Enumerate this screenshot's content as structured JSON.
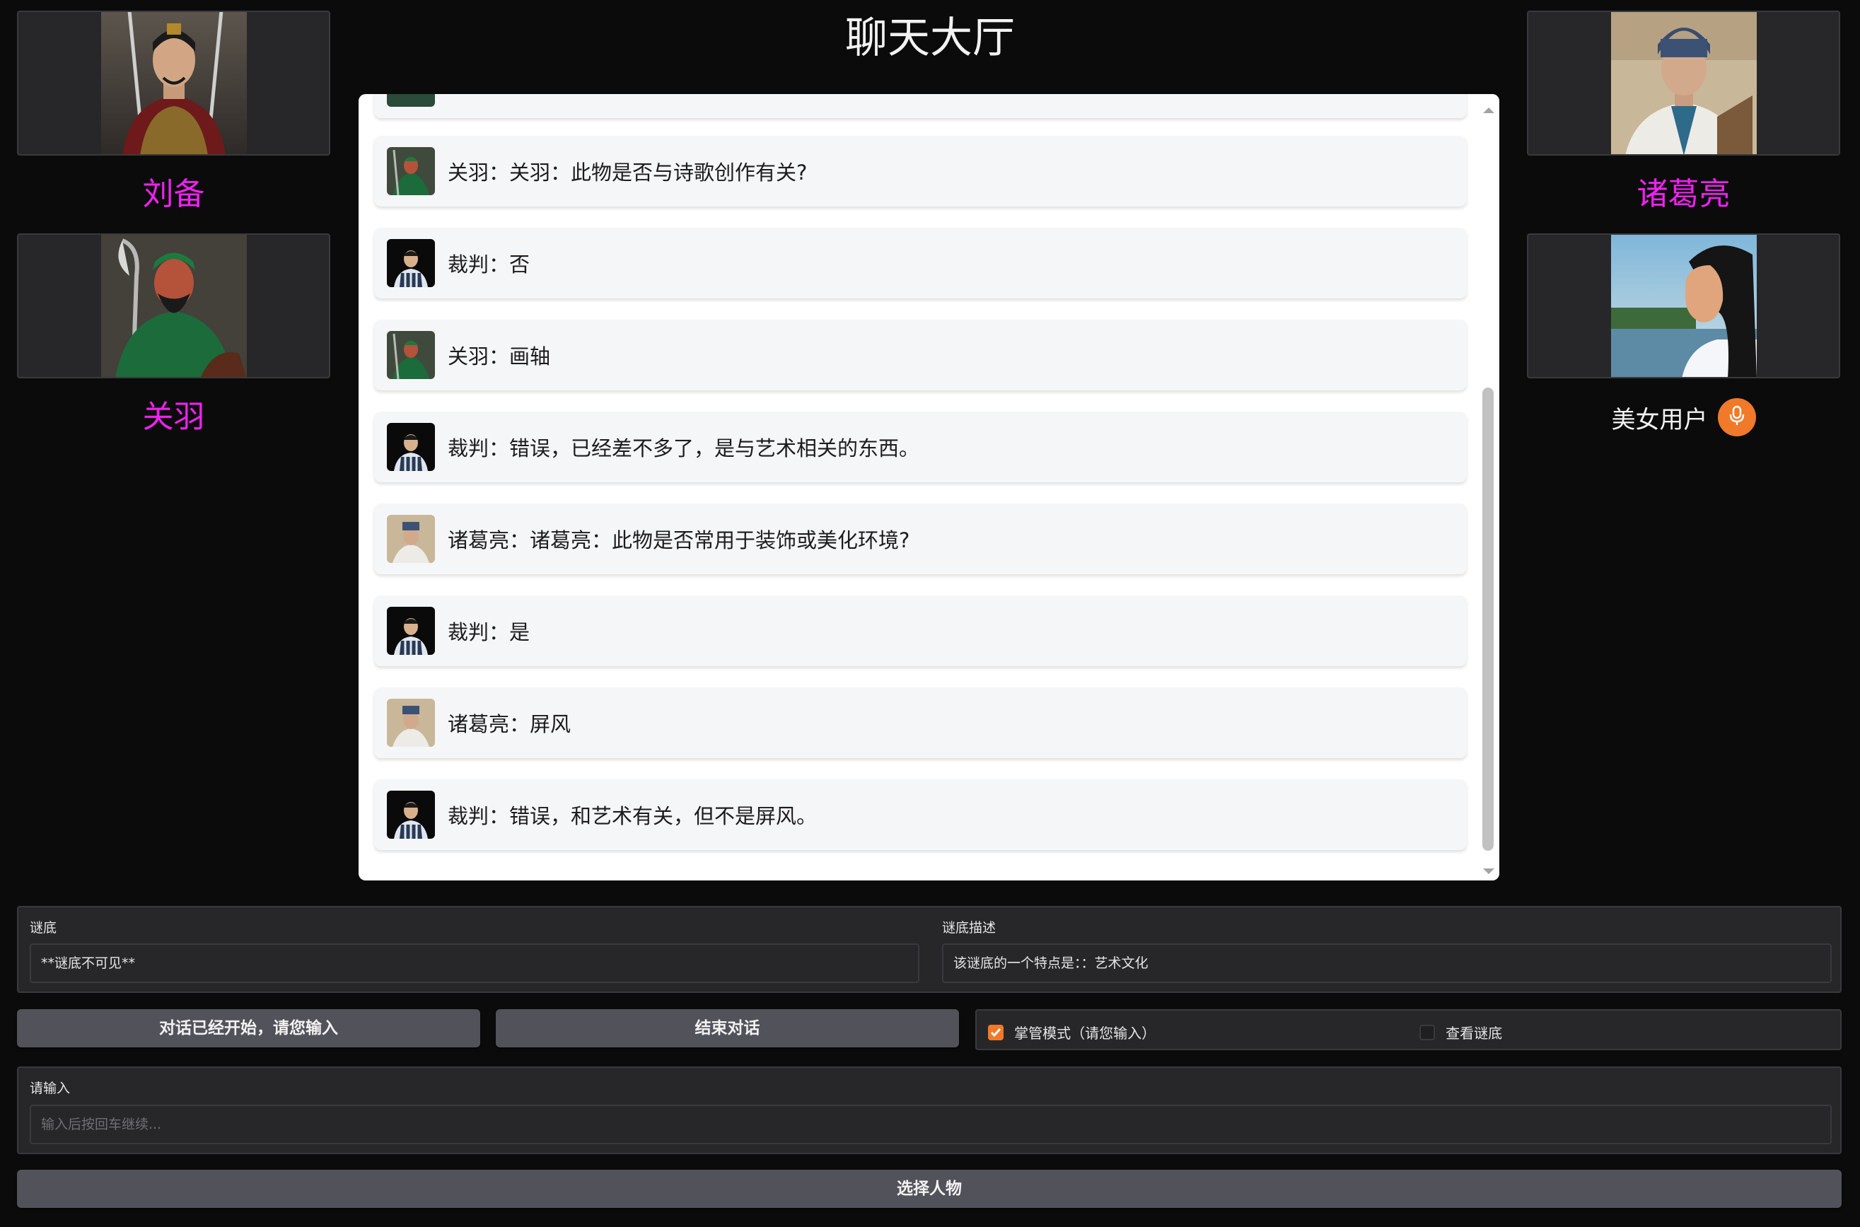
{
  "header": {
    "title": "聊天大厅"
  },
  "characters": {
    "left": [
      {
        "name": "刘备"
      },
      {
        "name": "关羽"
      }
    ],
    "right": [
      {
        "name": "诸葛亮"
      }
    ],
    "user": {
      "name": "美女用户",
      "icon": "microphone-icon",
      "accent": "#f07a2a"
    }
  },
  "chat": {
    "messages": [
      {
        "speaker": "guanyu",
        "text": "关羽：关羽：此物是否与诗歌创作有关?"
      },
      {
        "speaker": "referee",
        "text": "裁判：否"
      },
      {
        "speaker": "guanyu",
        "text": "关羽：画轴"
      },
      {
        "speaker": "referee",
        "text": "裁判：错误，已经差不多了，是与艺术相关的东西。"
      },
      {
        "speaker": "zhuge",
        "text": "诸葛亮：诸葛亮：此物是否常用于装饰或美化环境?"
      },
      {
        "speaker": "referee",
        "text": "裁判：是"
      },
      {
        "speaker": "zhuge",
        "text": "诸葛亮：屏风"
      },
      {
        "speaker": "referee",
        "text": "裁判：错误，和艺术有关，但不是屏风。"
      }
    ]
  },
  "riddle": {
    "answer_label": "谜底",
    "answer_value": "**谜底不可见**",
    "desc_label": "谜底描述",
    "desc_value": "该谜底的一个特点是：：艺术文化"
  },
  "controls": {
    "start_label": "对话已经开始，请您输入",
    "end_label": "结束对话",
    "host_mode_label": "掌管模式（请您输入）",
    "host_mode_checked": true,
    "show_answer_label": "查看谜底",
    "show_answer_checked": false
  },
  "input": {
    "label": "请输入",
    "placeholder": "输入后按回车继续..."
  },
  "footer": {
    "select_label": "选择人物"
  },
  "colors": {
    "accent": "#f07a2a",
    "name_color": "#ee22ee",
    "background": "#0b0b0c"
  }
}
